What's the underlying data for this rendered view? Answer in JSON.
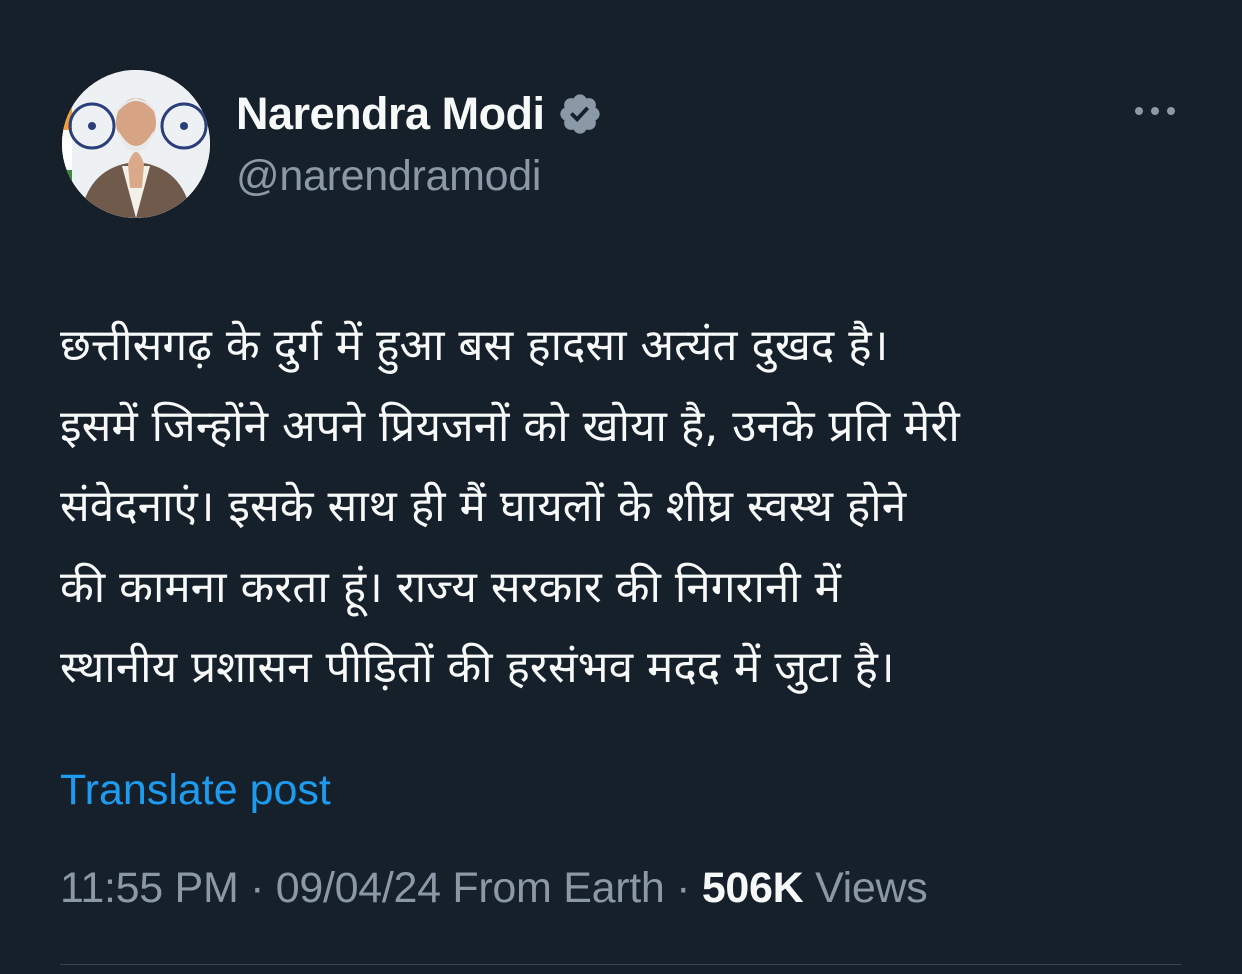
{
  "post": {
    "author": {
      "display_name": "Narendra Modi",
      "handle": "@narendramodi",
      "verified": true,
      "verified_color": "#8b98a5"
    },
    "more_icon": "more-horizontal-icon",
    "text_lines": [
      "छत्तीसगढ़ के दुर्ग में हुआ बस हादसा अत्यंत दुखद है।",
      "इसमें जिन्होंने अपने प्रियजनों को खोया है, उनके प्रति मेरी",
      "संवेदनाएं। इसके साथ ही मैं घायलों के शीघ्र स्वस्थ होने",
      "की कामना करता हूं। राज्य सरकार की निगरानी में",
      "स्थानीय प्रशासन पीड़ितों की हरसंभव मदद में जुटा है।"
    ],
    "translate_label": "Translate post",
    "meta": {
      "time": "11:55 PM",
      "sep1": " · ",
      "date": "09/04/24",
      "location": " From Earth",
      "sep2": " · ",
      "views_count": "506K",
      "views_label": " Views"
    }
  },
  "colors": {
    "background": "#15202b",
    "text_primary": "#f7f9f9",
    "text_secondary": "#8b98a5",
    "link": "#1d9bf0"
  }
}
